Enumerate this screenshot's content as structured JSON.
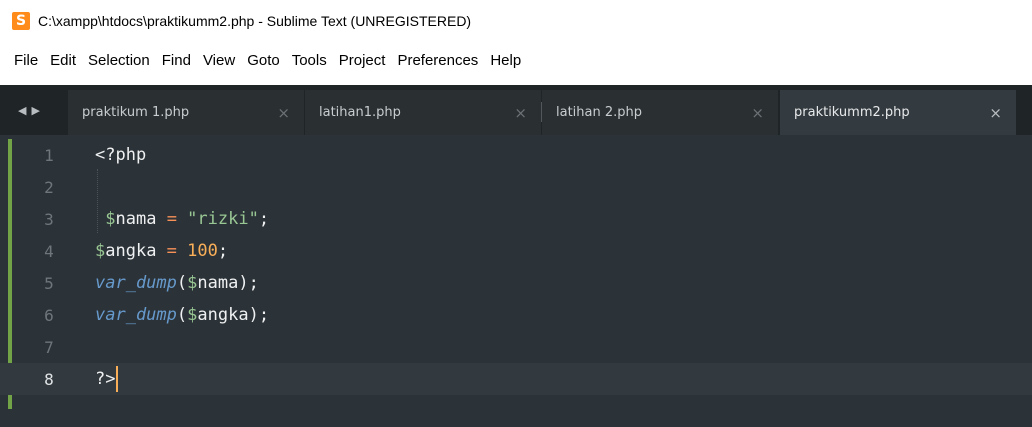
{
  "window": {
    "title": "C:\\xampp\\htdocs\\praktikumm2.php - Sublime Text (UNREGISTERED)"
  },
  "menu": {
    "items": [
      "File",
      "Edit",
      "Selection",
      "Find",
      "View",
      "Goto",
      "Tools",
      "Project",
      "Preferences",
      "Help"
    ]
  },
  "tabs": [
    {
      "label": "praktikum 1.php",
      "close": "×",
      "active": false
    },
    {
      "label": "latihan1.php",
      "close": "×",
      "active": false
    },
    {
      "label": "latihan 2.php",
      "close": "×",
      "active": false
    },
    {
      "label": "praktikumm2.php",
      "close": "×",
      "active": true
    }
  ],
  "editor": {
    "current_line": 8,
    "lines": [
      {
        "number": "1",
        "tokens": [
          {
            "t": "plain",
            "v": "<?php"
          }
        ]
      },
      {
        "number": "2",
        "tokens": []
      },
      {
        "number": "3",
        "tokens": [
          {
            "t": "plain",
            "v": " "
          },
          {
            "t": "var",
            "v": "$"
          },
          {
            "t": "plain",
            "v": "nama"
          },
          {
            "t": "op",
            "v": " = "
          },
          {
            "t": "str",
            "v": "\"rizki\""
          },
          {
            "t": "plain",
            "v": ";"
          }
        ]
      },
      {
        "number": "4",
        "tokens": [
          {
            "t": "var",
            "v": "$"
          },
          {
            "t": "plain",
            "v": "angka"
          },
          {
            "t": "op",
            "v": " = "
          },
          {
            "t": "num",
            "v": "100"
          },
          {
            "t": "plain",
            "v": ";"
          }
        ]
      },
      {
        "number": "5",
        "tokens": [
          {
            "t": "fn",
            "v": "var_dump"
          },
          {
            "t": "plain",
            "v": "("
          },
          {
            "t": "var",
            "v": "$"
          },
          {
            "t": "plain",
            "v": "nama"
          },
          {
            "t": "plain",
            "v": ");"
          }
        ]
      },
      {
        "number": "6",
        "tokens": [
          {
            "t": "fn",
            "v": "var_dump"
          },
          {
            "t": "plain",
            "v": "("
          },
          {
            "t": "var",
            "v": "$"
          },
          {
            "t": "plain",
            "v": "angka"
          },
          {
            "t": "plain",
            "v": ");"
          }
        ]
      },
      {
        "number": "7",
        "tokens": []
      },
      {
        "number": "8",
        "tokens": [
          {
            "t": "plain",
            "v": "?>"
          }
        ]
      }
    ]
  },
  "colors": {
    "editor_bg": "#2c3338",
    "tabbar_bg": "#1f2426",
    "active_tab_bg": "#343b40",
    "string": "#99c794",
    "number": "#f9ae58",
    "function": "#6699cc",
    "operator": "#f99157",
    "caret": "#f9ae58"
  }
}
